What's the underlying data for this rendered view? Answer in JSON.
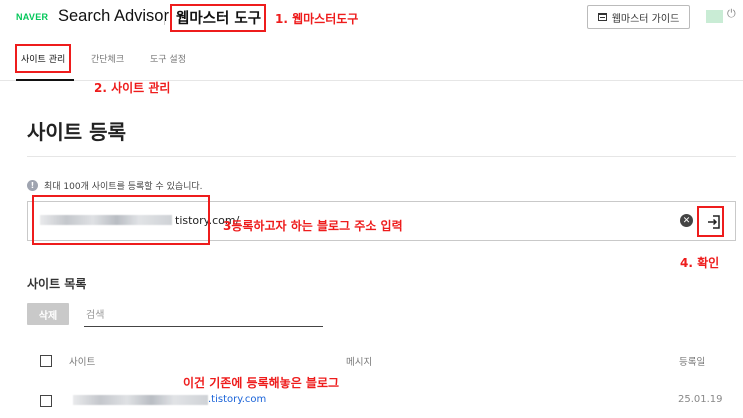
{
  "header": {
    "brand": "NAVER",
    "product": "Search Advisor",
    "tool_title": "웹마스터 도구",
    "guide_button": "웹마스터 가이드",
    "power_icon": "power-icon",
    "guide_icon": "document-icon"
  },
  "tabs": [
    {
      "label": "사이트 관리",
      "active": true
    },
    {
      "label": "간단체크",
      "active": false
    },
    {
      "label": "도구 설정",
      "active": false
    }
  ],
  "annotations": {
    "step1": "1. 웹마스터도구",
    "step2": "2. 사이트 관리",
    "step3": "3등록하고자 하는 블로그 주소 입력",
    "step4": "4. 확인",
    "existing": "이건 기존에 등록해놓은 블로그"
  },
  "register": {
    "title": "사이트 등록",
    "notice": "최대 100개 사이트를 등록할 수 있습니다.",
    "url_suffix": "tistory.com/",
    "clear_icon": "clear-circle-icon",
    "confirm_icon": "enter-arrow-icon"
  },
  "site_list": {
    "title": "사이트 목록",
    "delete_button": "삭제",
    "search_placeholder": "검색",
    "columns": {
      "site": "사이트",
      "message": "메시지",
      "date": "등록일"
    },
    "rows": [
      {
        "site_suffix": ".tistory.com",
        "message": "",
        "date": "25.01.19"
      }
    ]
  },
  "colors": {
    "brand_green": "#03c75a",
    "annotation_red": "#ee1c1c",
    "link_blue": "#1a63d8"
  }
}
